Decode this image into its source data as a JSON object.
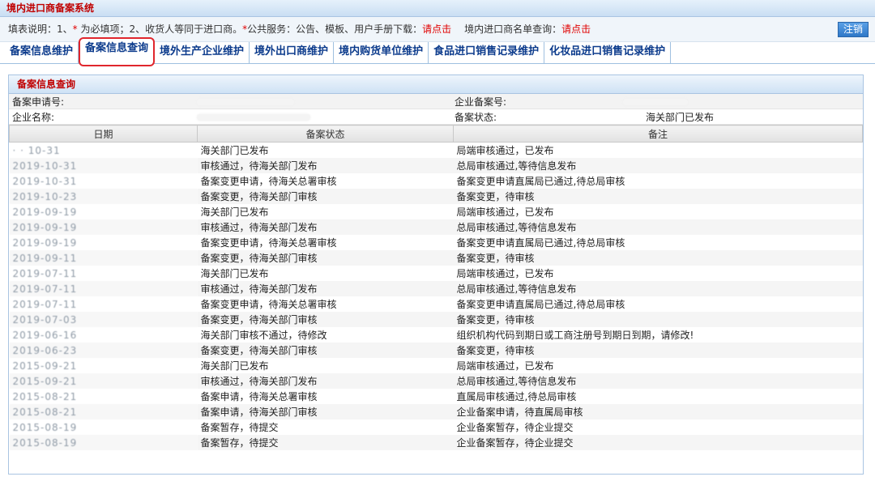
{
  "app": {
    "title": "境内进口商备案系统",
    "logout_label": "注销"
  },
  "notice": {
    "prefix": "填表说明：1、",
    "star": "*",
    "required": " 为必填项；2、收货人等同于进口商。",
    "star2": "*",
    "public": "公共服务：公告、模板、用户手册下载：",
    "link1": "请点击",
    "list_query": "境内进口商名单查询：",
    "link2": "请点击"
  },
  "tabs": [
    {
      "label": "备案信息维护"
    },
    {
      "label": "备案信息查询"
    },
    {
      "label": "境外生产企业维护"
    },
    {
      "label": "境外出口商维护"
    },
    {
      "label": "境内购货单位维护"
    },
    {
      "label": "食品进口销售记录维护"
    },
    {
      "label": "化妆品进口销售记录维护"
    }
  ],
  "panel": {
    "title": "备案信息查询",
    "fields": {
      "apply_no_label": "备案申请号:",
      "enterprise_no_label": "企业备案号:",
      "enterprise_name_label": "企业名称:",
      "status_label": "备案状态:",
      "status_value": "海关部门已发布"
    }
  },
  "records": {
    "columns": [
      "日期",
      "备案状态",
      "备注"
    ],
    "rows": [
      {
        "date": "· · 10-31",
        "status": "海关部门已发布",
        "note": "局端审核通过，已发布"
      },
      {
        "date": "2019-10-31",
        "status": "审核通过，待海关部门发布",
        "note": "总局审核通过,等待信息发布"
      },
      {
        "date": "2019-10-31",
        "status": "备案变更申请，待海关总署审核",
        "note": "备案变更申请直属局已通过,待总局审核"
      },
      {
        "date": "2019-10-23",
        "status": "备案变更，待海关部门审核",
        "note": "备案变更，待审核"
      },
      {
        "date": "2019-09-19",
        "status": "海关部门已发布",
        "note": "局端审核通过，已发布"
      },
      {
        "date": "2019-09-19",
        "status": "审核通过，待海关部门发布",
        "note": "总局审核通过,等待信息发布"
      },
      {
        "date": "2019-09-19",
        "status": "备案变更申请，待海关总署审核",
        "note": "备案变更申请直属局已通过,待总局审核"
      },
      {
        "date": "2019-09-11",
        "status": "备案变更，待海关部门审核",
        "note": "备案变更，待审核"
      },
      {
        "date": "2019-07-11",
        "status": "海关部门已发布",
        "note": "局端审核通过，已发布"
      },
      {
        "date": "2019-07-11",
        "status": "审核通过，待海关部门发布",
        "note": "总局审核通过,等待信息发布"
      },
      {
        "date": "2019-07-11",
        "status": "备案变更申请，待海关总署审核",
        "note": "备案变更申请直属局已通过,待总局审核"
      },
      {
        "date": "2019-07-03",
        "status": "备案变更，待海关部门审核",
        "note": "备案变更，待审核"
      },
      {
        "date": "2019-06-16",
        "status": "海关部门审核不通过，待修改",
        "note": "组织机构代码到期日或工商注册号到期日到期，请修改!"
      },
      {
        "date": "2019-06-23",
        "status": "备案变更，待海关部门审核",
        "note": "备案变更，待审核"
      },
      {
        "date": "2015-09-21",
        "status": "海关部门已发布",
        "note": "局端审核通过，已发布"
      },
      {
        "date": "2015-09-21",
        "status": "审核通过，待海关部门发布",
        "note": "总局审核通过,等待信息发布"
      },
      {
        "date": "2015-08-21",
        "status": "备案申请，待海关总署审核",
        "note": "直属局审核通过,待总局审核"
      },
      {
        "date": "2015-08-21",
        "status": "备案申请，待海关部门审核",
        "note": "企业备案申请，待直属局审核"
      },
      {
        "date": "2015-08-19",
        "status": "备案暂存，待提交",
        "note": "企业备案暂存，待企业提交"
      },
      {
        "date": "2015-08-19",
        "status": "备案暂存，待提交",
        "note": "企业备案暂存，待企业提交"
      }
    ]
  }
}
